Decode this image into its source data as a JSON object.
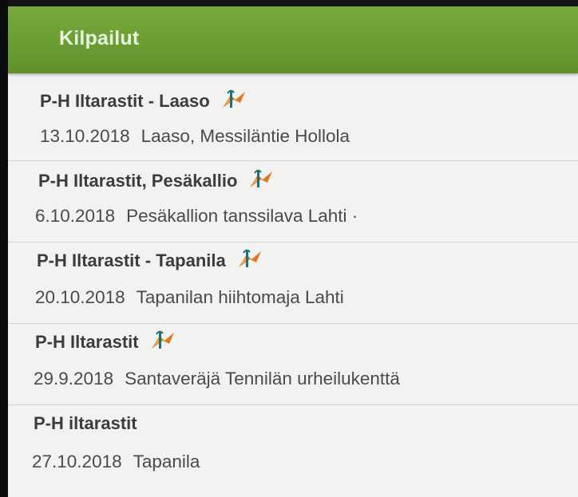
{
  "appbar": {
    "title": "Kilpailut"
  },
  "competitions": [
    {
      "name": "P-H Iltarastit - Laaso",
      "date": "13.10.2018",
      "location": "Laaso, Messiläntie Hollola",
      "logo": "orienteering-flag-icon"
    },
    {
      "name": "P-H Iltarastit, Pesäkallio",
      "date": "6.10.2018",
      "location": "Pesäkallion tanssilava Lahti ·",
      "logo": "orienteering-flag-icon"
    },
    {
      "name": "P-H Iltarastit - Tapanila",
      "date": "20.10.2018",
      "location": "Tapanilan hiihtomaja Lahti",
      "logo": "orienteering-flag-icon"
    },
    {
      "name": "P-H Iltarastit",
      "date": "29.9.2018",
      "location": "Santaveräjä Tennilän urheilukenttä",
      "logo": "orienteering-flag-icon"
    },
    {
      "name": "P-H iltarastit",
      "date": "27.10.2018",
      "location": "Tapanila"
    }
  ],
  "colors": {
    "appbar": "#6a9c34",
    "background": "#f2f2f0",
    "logo_orange": "#e07a22",
    "logo_teal": "#1d6f7a"
  }
}
